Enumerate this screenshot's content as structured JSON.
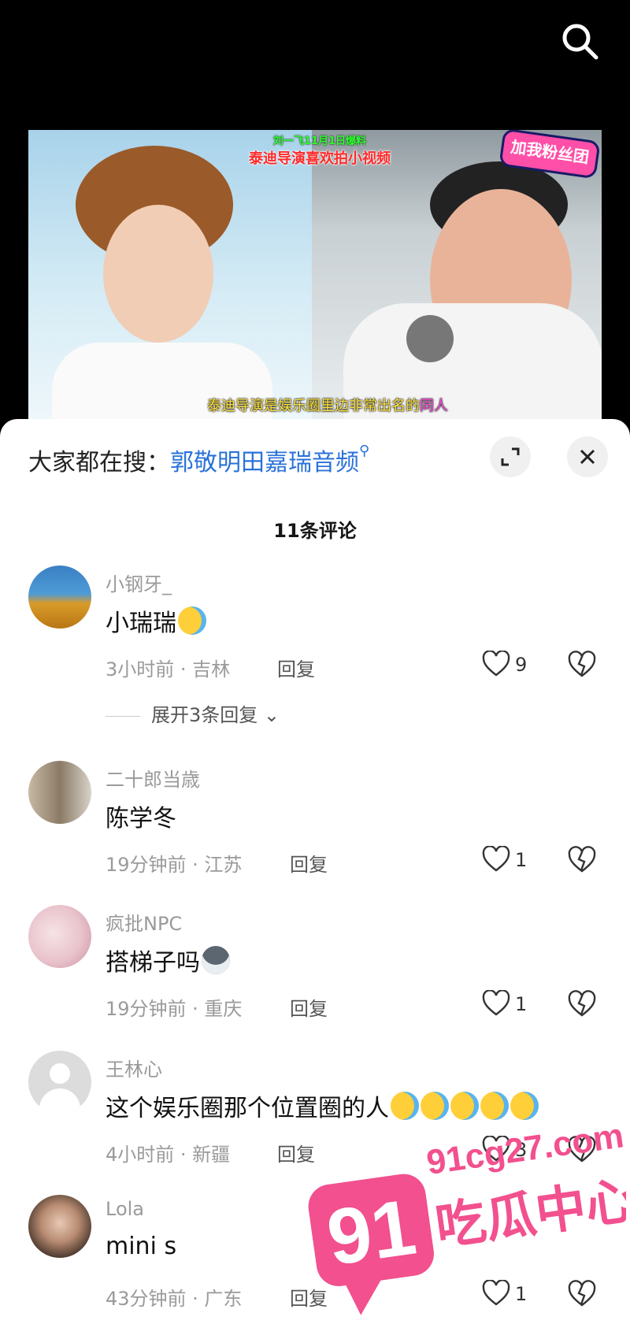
{
  "header": {
    "search_icon": "search-icon"
  },
  "video": {
    "caption_top": "刘一飞11月1日爆料",
    "caption_title": "泰迪导演喜欢拍小视频",
    "fan_badge": "加我粉丝团",
    "subtitle_main": "泰迪导演是娱乐圈里边非常出名的",
    "subtitle_highlight": "同人"
  },
  "sheet": {
    "hot_search_label": "大家都在搜：",
    "hot_search_keyword": "郭敬明田嘉瑞音频",
    "expand_icon": "expand-icon",
    "close_icon": "close-icon",
    "comment_count": "11条评论"
  },
  "comments": [
    {
      "username": "小钢牙_",
      "text": "小瑞瑞",
      "emoji": "laughing-tears-emoji",
      "time_location": "3小时前 · 吉林",
      "reply": "回复",
      "likes": "9",
      "expand": "展开3条回复"
    },
    {
      "username": "二十郎当歳",
      "text": "陈学冬",
      "time_location": "19分钟前 · 江苏",
      "reply": "回复",
      "likes": "1"
    },
    {
      "username": "疯批NPC",
      "text": "搭梯子吗",
      "emoji": "husky-dog-emoji",
      "time_location": "19分钟前 · 重庆",
      "reply": "回复",
      "likes": "1"
    },
    {
      "username": "王林心",
      "text": "这个娱乐圈那个位置圈的人",
      "emoji": "laughing-tears-emoji-x5",
      "time_location": "4小时前 · 新疆",
      "reply": "回复",
      "likes": "3"
    },
    {
      "username": "Lola",
      "text": "mini s",
      "time_location": "43分钟前 · 广东",
      "reply": "回复",
      "likes": "1"
    }
  ],
  "watermark": {
    "number": "91",
    "domain": "91cg27.com",
    "name": "吃瓜中心"
  },
  "colors": {
    "keyword_blue": "#2a72d9",
    "watermark_pink": "#f2508e"
  }
}
